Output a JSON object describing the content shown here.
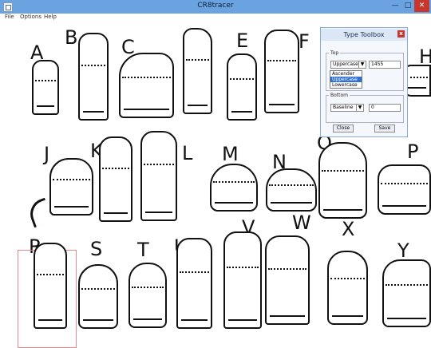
{
  "window": {
    "title": "CR8tracer"
  },
  "titlebar": {
    "min": "—",
    "max": "□",
    "close": "✕"
  },
  "menu": [
    "File",
    "Options",
    "Help"
  ],
  "letters": [
    "A",
    "B",
    "C",
    "D",
    "E",
    "F",
    "H",
    "J",
    "K",
    "L",
    "M",
    "N",
    "O",
    "P",
    "R",
    "S",
    "T",
    "U",
    "V",
    "W",
    "X",
    "Y"
  ],
  "dialog": {
    "title": "Type Toolbox",
    "close": "x",
    "top_label": "Top",
    "top_select": "Uppercase",
    "top_value": "1455",
    "dropdown": [
      "Ascender",
      "Uppercase",
      "Lowercase"
    ],
    "bottom_label": "Bottom",
    "bottom_select": "Baseline",
    "bottom_value": "0",
    "close_button": "Close",
    "save_button": "Save"
  }
}
